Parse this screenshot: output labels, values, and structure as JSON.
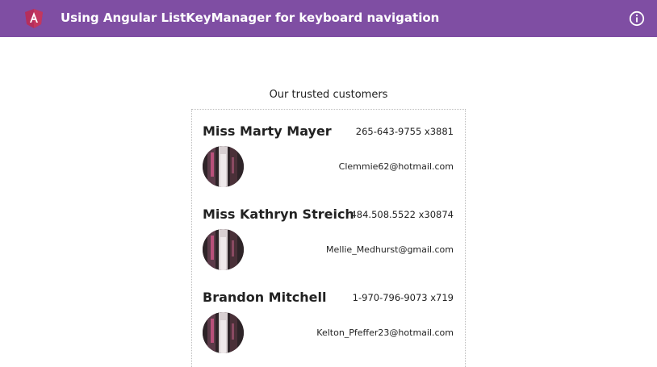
{
  "header": {
    "title": "Using Angular ListKeyManager for keyboard navigation",
    "logo_icon": "angular-logo-icon",
    "info_icon": "info-icon",
    "background_color": "#7f4ea3"
  },
  "main": {
    "heading": "Our trusted customers",
    "customers": [
      {
        "name": "Miss Marty Mayer",
        "phone": "265-643-9755 x3881",
        "email": "Clemmie62@hotmail.com",
        "avatar_icon": "avatar-image"
      },
      {
        "name": "Miss Kathryn Streich",
        "phone": "484.508.5522 x30874",
        "email": "Mellie_Medhurst@gmail.com",
        "avatar_icon": "avatar-image"
      },
      {
        "name": "Brandon Mitchell",
        "phone": "1-970-796-9073 x719",
        "email": "Kelton_Pfeffer23@hotmail.com",
        "avatar_icon": "avatar-image"
      }
    ]
  }
}
